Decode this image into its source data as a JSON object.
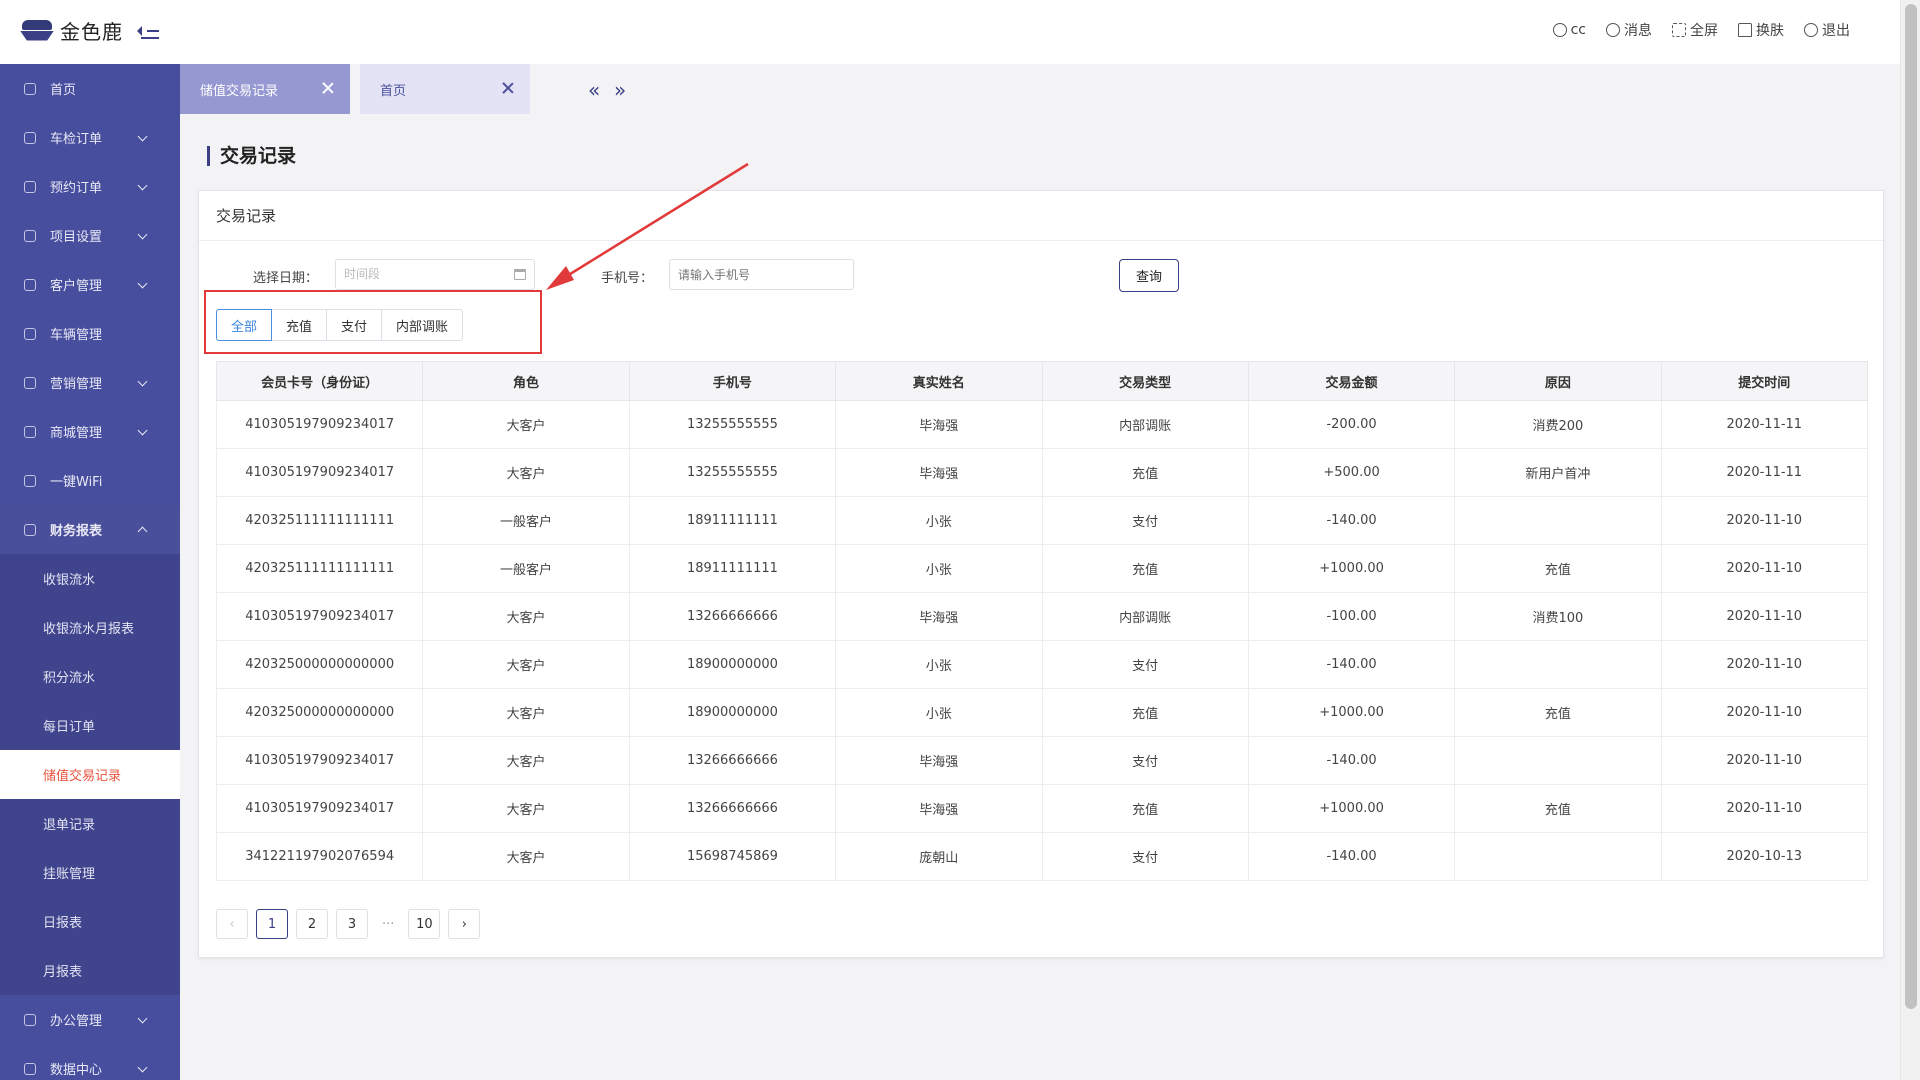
{
  "brand": {
    "name": "金色鹿"
  },
  "header": {
    "actions": [
      {
        "label": "cc",
        "icon": "user-icon"
      },
      {
        "label": "消息",
        "icon": "message-icon"
      },
      {
        "label": "全屏",
        "icon": "fullscreen-icon"
      },
      {
        "label": "换肤",
        "icon": "shirt-icon"
      },
      {
        "label": "退出",
        "icon": "power-icon"
      }
    ]
  },
  "sidebar": {
    "items": [
      {
        "label": "首页",
        "icon": "home-icon"
      },
      {
        "label": "车检订单",
        "icon": "search-icon"
      },
      {
        "label": "预约订单",
        "icon": "box-icon"
      },
      {
        "label": "项目设置",
        "icon": "settings-icon"
      },
      {
        "label": "客户管理",
        "icon": "customer-icon"
      },
      {
        "label": "车辆管理",
        "icon": "car-icon"
      },
      {
        "label": "营销管理",
        "icon": "tag-icon"
      },
      {
        "label": "商城管理",
        "icon": "shop-icon"
      },
      {
        "label": "一键WiFi",
        "icon": "wifi-icon"
      },
      {
        "label": "财务报表",
        "icon": "finance-icon"
      },
      {
        "label": "办公管理",
        "icon": "office-icon"
      },
      {
        "label": "数据中心",
        "icon": "data-icon"
      }
    ],
    "finance_sub": [
      "收银流水",
      "收银流水月报表",
      "积分流水",
      "每日订单",
      "储值交易记录",
      "退单记录",
      "挂账管理",
      "日报表",
      "月报表"
    ]
  },
  "tabs": [
    {
      "label": "储值交易记录"
    },
    {
      "label": "首页"
    }
  ],
  "page": {
    "title": "交易记录",
    "card_title": "交易记录"
  },
  "filters": {
    "date_label": "选择日期：",
    "date_placeholder": "时间段",
    "phone_label": "手机号：",
    "phone_placeholder": "请输入手机号",
    "query_label": "查询",
    "segments": [
      "全部",
      "充值",
      "支付",
      "内部调账"
    ],
    "active_segment": "全部"
  },
  "table": {
    "columns": [
      "会员卡号（身份证）",
      "角色",
      "手机号",
      "真实姓名",
      "交易类型",
      "交易金额",
      "原因",
      "提交时间"
    ],
    "rows": [
      [
        "410305197909234017",
        "大客户",
        "13255555555",
        "毕海强",
        "内部调账",
        "-200.00",
        "消费200",
        "2020-11-11"
      ],
      [
        "410305197909234017",
        "大客户",
        "13255555555",
        "毕海强",
        "充值",
        "+500.00",
        "新用户首冲",
        "2020-11-11"
      ],
      [
        "420325111111111111",
        "一般客户",
        "18911111111",
        "小张",
        "支付",
        "-140.00",
        "",
        "2020-11-10"
      ],
      [
        "420325111111111111",
        "一般客户",
        "18911111111",
        "小张",
        "充值",
        "+1000.00",
        "充值",
        "2020-11-10"
      ],
      [
        "410305197909234017",
        "大客户",
        "13266666666",
        "毕海强",
        "内部调账",
        "-100.00",
        "消费100",
        "2020-11-10"
      ],
      [
        "420325000000000000",
        "大客户",
        "18900000000",
        "小张",
        "支付",
        "-140.00",
        "",
        "2020-11-10"
      ],
      [
        "420325000000000000",
        "大客户",
        "18900000000",
        "小张",
        "充值",
        "+1000.00",
        "充值",
        "2020-11-10"
      ],
      [
        "410305197909234017",
        "大客户",
        "13266666666",
        "毕海强",
        "支付",
        "-140.00",
        "",
        "2020-11-10"
      ],
      [
        "410305197909234017",
        "大客户",
        "13266666666",
        "毕海强",
        "充值",
        "+1000.00",
        "充值",
        "2020-11-10"
      ],
      [
        "341221197902076594",
        "大客户",
        "15698745869",
        "庞朝山",
        "支付",
        "-140.00",
        "",
        "2020-10-13"
      ]
    ]
  },
  "pagination": {
    "pages": [
      "1",
      "2",
      "3",
      "···",
      "10"
    ],
    "current": "1",
    "prev": "‹",
    "next": "›"
  },
  "colors": {
    "sidebar": "#484e9e",
    "accent": "#3a3f86",
    "active_menu_text": "#e8543d",
    "annotation": "#e03a3a",
    "segment_active": "#3d86e2"
  }
}
